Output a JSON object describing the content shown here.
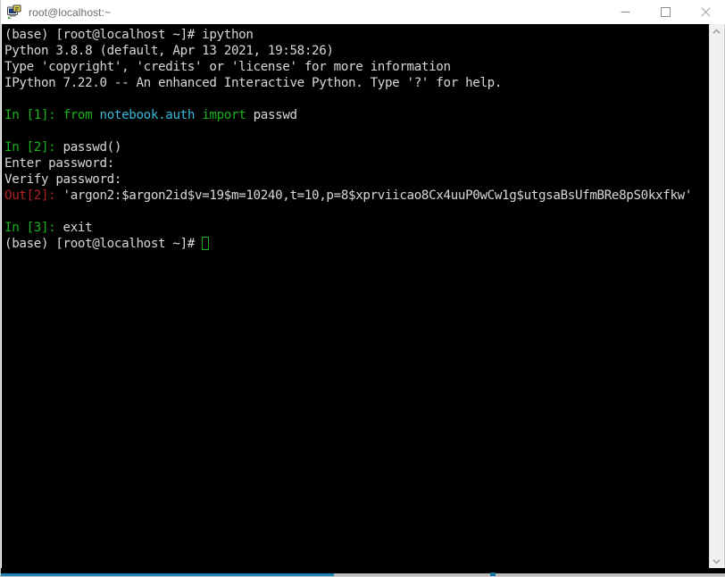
{
  "window": {
    "title": "root@localhost:~",
    "icon": "putty-terminal-icon",
    "minimize_label": "—",
    "maximize_label": "□",
    "close_label": "✕"
  },
  "terminal": {
    "background": "#000000",
    "foreground": "#d4d4d4",
    "prompt_color": "#19b219",
    "out_color": "#b22222",
    "module_color": "#38b8d8",
    "keyword_color": "#19b219",
    "lines": [
      {
        "segments": [
          {
            "text": "(base) [root@localhost ~]# ipython",
            "color": "white"
          }
        ]
      },
      {
        "segments": [
          {
            "text": "Python 3.8.8 (default, Apr 13 2021, 19:58:26)",
            "color": "white"
          }
        ]
      },
      {
        "segments": [
          {
            "text": "Type 'copyright', 'credits' or 'license' for more information",
            "color": "white"
          }
        ]
      },
      {
        "segments": [
          {
            "text": "IPython 7.22.0 -- An enhanced Interactive Python. Type '?' for help.",
            "color": "white"
          }
        ]
      },
      {
        "segments": [
          {
            "text": "",
            "color": "white"
          }
        ]
      },
      {
        "segments": [
          {
            "text": "In [1]:",
            "color": "green"
          },
          {
            "text": " ",
            "color": "white"
          },
          {
            "text": "from",
            "color": "green"
          },
          {
            "text": " ",
            "color": "white"
          },
          {
            "text": "notebook.auth",
            "color": "cyan"
          },
          {
            "text": " ",
            "color": "white"
          },
          {
            "text": "import",
            "color": "green"
          },
          {
            "text": " passwd",
            "color": "white"
          }
        ]
      },
      {
        "segments": [
          {
            "text": "",
            "color": "white"
          }
        ]
      },
      {
        "segments": [
          {
            "text": "In [2]:",
            "color": "green"
          },
          {
            "text": " passwd()",
            "color": "white"
          }
        ]
      },
      {
        "segments": [
          {
            "text": "Enter password:",
            "color": "white"
          }
        ]
      },
      {
        "segments": [
          {
            "text": "Verify password:",
            "color": "white"
          }
        ]
      },
      {
        "segments": [
          {
            "text": "Out[2]:",
            "color": "red"
          },
          {
            "text": " 'argon2:$argon2id$v=19$m=10240,t=10,p=8$xprviicao8Cx4uuP0wCw1g$utgsaBsUfmBRe8pS0kxfkw'",
            "color": "white"
          }
        ]
      },
      {
        "segments": [
          {
            "text": "",
            "color": "white"
          }
        ]
      },
      {
        "segments": [
          {
            "text": "In [3]:",
            "color": "green"
          },
          {
            "text": " exit",
            "color": "white"
          }
        ]
      },
      {
        "segments": [
          {
            "text": "(base) [root@localhost ~]# ",
            "color": "white"
          },
          {
            "text": "",
            "color": "white",
            "cursor": true
          }
        ]
      }
    ]
  },
  "scrollbars": {
    "vertical_up_arrow": "chevron-up",
    "vertical_down_arrow": "chevron-down",
    "horizontal_thumb_color": "#1b86b5"
  }
}
